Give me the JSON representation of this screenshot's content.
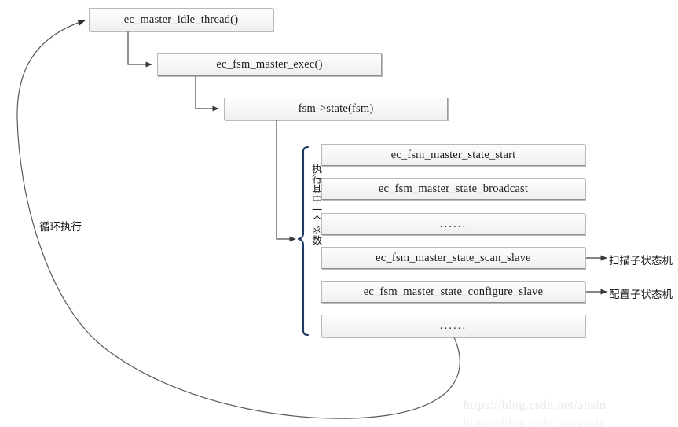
{
  "diagram": {
    "title_nodes": {
      "idle_thread": "ec_master_idle_thread()",
      "fsm_exec": "ec_fsm_master_exec()",
      "fsm_state_call": "fsm->state(fsm)"
    },
    "states": [
      {
        "label": "ec_fsm_master_state_start",
        "note": ""
      },
      {
        "label": "ec_fsm_master_state_broadcast",
        "note": ""
      },
      {
        "label": "......",
        "note": ""
      },
      {
        "label": "ec_fsm_master_state_scan_slave",
        "note": "扫描子状态机"
      },
      {
        "label": "ec_fsm_master_state_configure_slave",
        "note": "配置子状态机"
      },
      {
        "label": "......",
        "note": ""
      }
    ],
    "brace_label": "执行其中一个函数",
    "loop_label": "循环执行",
    "watermark": {
      "line1": "https://blog.csdn.net/absin",
      "line2": "https://blog.csdn.net/absin"
    },
    "colors": {
      "brace": "#1f3864",
      "connector": "#4a4a4a",
      "loop_curve": "#5a5a5a",
      "box_border": "#b9b9b9",
      "box_fill": "#f7f7f7",
      "text": "#1a1a1a"
    }
  }
}
